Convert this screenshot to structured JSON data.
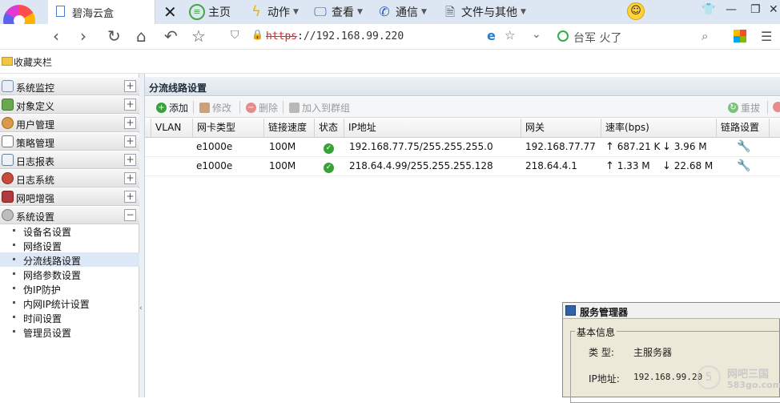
{
  "browser": {
    "tab_title": "碧海云盒",
    "menu": [
      {
        "label": "主页",
        "icon": "home-icon"
      },
      {
        "label": "动作",
        "icon": "lightning-icon"
      },
      {
        "label": "查看",
        "icon": "monitor-icon"
      },
      {
        "label": "通信",
        "icon": "phone-icon"
      },
      {
        "label": "文件与其他",
        "icon": "document-icon"
      }
    ],
    "url_scheme": "https",
    "url_rest": "://192.168.99.220",
    "search_text": "台军 火了",
    "favorites": "收藏夹栏"
  },
  "sidebar": {
    "categories": [
      {
        "label": "系统监控",
        "toggle": "+"
      },
      {
        "label": "对象定义",
        "toggle": "+"
      },
      {
        "label": "用户管理",
        "toggle": "+"
      },
      {
        "label": "策略管理",
        "toggle": "+"
      },
      {
        "label": "日志报表",
        "toggle": "+"
      },
      {
        "label": "日志系统",
        "toggle": "+"
      },
      {
        "label": "网吧增强",
        "toggle": "+"
      },
      {
        "label": "系统设置",
        "toggle": "−"
      }
    ],
    "subitems": [
      "设备名设置",
      "网络设置",
      "分流线路设置",
      "网络参数设置",
      "伪IP防护",
      "内网IP统计设置",
      "时间设置",
      "管理员设置"
    ],
    "active_subitem": "分流线路设置"
  },
  "panel": {
    "title": "分流线路设置",
    "toolbar": {
      "add": "添加",
      "edit": "修改",
      "delete": "删除",
      "join_group": "加入到群组",
      "redial": "重拔"
    },
    "columns": [
      "VLAN",
      "网卡类型",
      "链接速度",
      "状态",
      "IP地址",
      "网关",
      "速率(bps)",
      "链路设置"
    ],
    "rows": [
      {
        "vlan": "",
        "nic": "e1000e",
        "speed": "100M",
        "status": "ok",
        "ip": "192.168.77.75/255.255.255.0",
        "gateway": "192.168.77.77",
        "up": "687.21 K",
        "down": "3.96 M"
      },
      {
        "vlan": "",
        "nic": "e1000e",
        "speed": "100M",
        "status": "ok",
        "ip": "218.64.4.99/255.255.255.128",
        "gateway": "218.64.4.1",
        "up": "1.33 M",
        "down": "22.68 M"
      }
    ]
  },
  "popup": {
    "title": "服务管理器",
    "group_title": "基本信息",
    "type_label": "类 型:",
    "type_value": "主服务器",
    "ip_label": "IP地址:",
    "ip_value": "192.168.99.20"
  },
  "watermark": {
    "ring": "5",
    "line1": "网吧三国",
    "line2": "583go.com"
  },
  "colors": {
    "ok": "#37a336",
    "accent": "#2f63a8",
    "https": "#d02b2b"
  }
}
